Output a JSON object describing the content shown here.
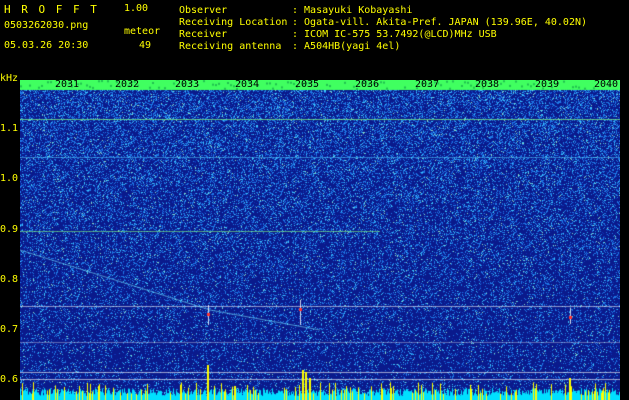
{
  "header": {
    "app_title": "H R O F F T",
    "version": "1.00",
    "filename": "0503262030.png",
    "datetime": "05.03.26 20:30",
    "meteor_label": "meteor",
    "meteor_count": "49"
  },
  "station": {
    "observer_label": "Observer",
    "observer_value": ": Masayuki Kobayashi",
    "location_label": "Receiving Location",
    "location_value": ": Ogata-vill. Akita-Pref. JAPAN (139.96E, 40.02N)",
    "receiver_label": "Receiver",
    "receiver_value": ": ICOM IC-575 53.7492(@LCD)MHz USB",
    "antenna_label": "Receiving antenna",
    "antenna_value": ": A504HB(yagi 4el)"
  },
  "axis": {
    "y_unit": "kHz",
    "y_ticks": [
      "1.1",
      "1.0",
      "0.9",
      "0.8",
      "0.7",
      "0.6"
    ],
    "x_ticks": [
      "2031",
      "2032",
      "2033",
      "2034",
      "2035",
      "2036",
      "2037",
      "2038",
      "2039",
      "2040"
    ]
  },
  "colors": {
    "background": "#000000",
    "header_text": "#ffff00",
    "spectrum_base": "#0a1a8c",
    "noise_bright": "#2fa0ff",
    "signal_line": "#7fff7f",
    "peak_yellow": "#ffff00",
    "floor_cyan": "#00ffff"
  }
}
